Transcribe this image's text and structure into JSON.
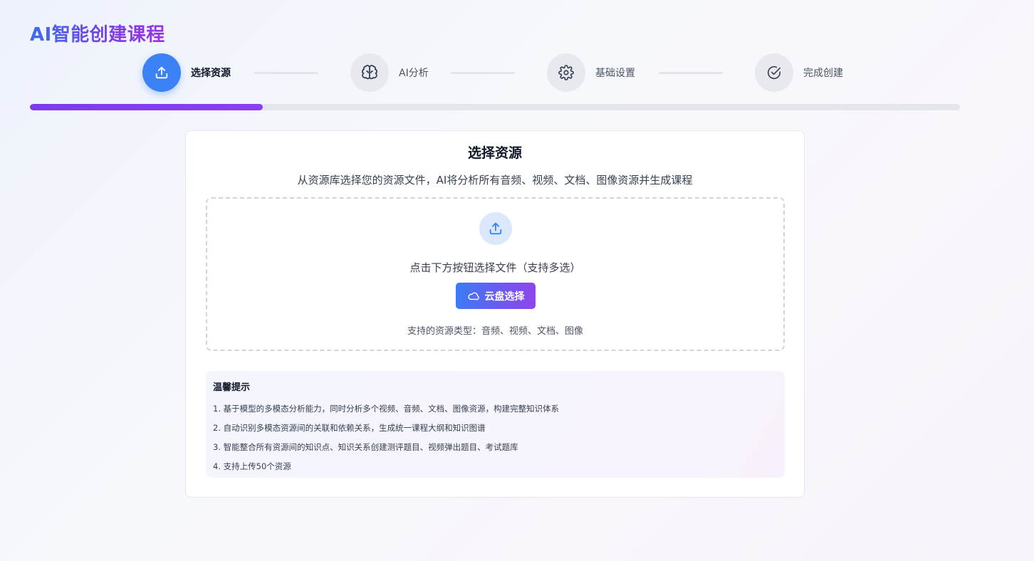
{
  "page": {
    "title": "AI智能创建课程"
  },
  "steps": [
    {
      "label": "选择资源",
      "icon": "upload-icon",
      "active": true
    },
    {
      "label": "AI分析",
      "icon": "brain-icon",
      "active": false
    },
    {
      "label": "基础设置",
      "icon": "gear-icon",
      "active": false
    },
    {
      "label": "完成创建",
      "icon": "check-circle-icon",
      "active": false
    }
  ],
  "progress": {
    "fraction": 0.25
  },
  "card": {
    "title": "选择资源",
    "subtitle": "从资源库选择您的资源文件，AI将分析所有音频、视频、文档、图像资源并生成课程",
    "dropzone": {
      "icon": "upload-icon",
      "instruction": "点击下方按钮选择文件（支持多选）",
      "button_label": "云盘选择",
      "button_icon": "cloud-icon",
      "types": "支持的资源类型：音频、视频、文档、图像"
    },
    "tips": {
      "title": "温馨提示",
      "items": [
        "1. 基于模型的多模态分析能力，同时分析多个视频、音频、文档、图像资源，构建完整知识体系",
        "2. 自动识别多模态资源间的关联和依赖关系，生成统一课程大纲和知识图谱",
        "3. 智能整合所有资源间的知识点、知识关系创建测评题目、视频弹出题目、考试题库",
        "4. 支持上传50个资源"
      ]
    }
  },
  "colors": {
    "accent": "#3b82f6",
    "progress": "#7c3aed",
    "step_inactive": "#e8e9ee"
  }
}
